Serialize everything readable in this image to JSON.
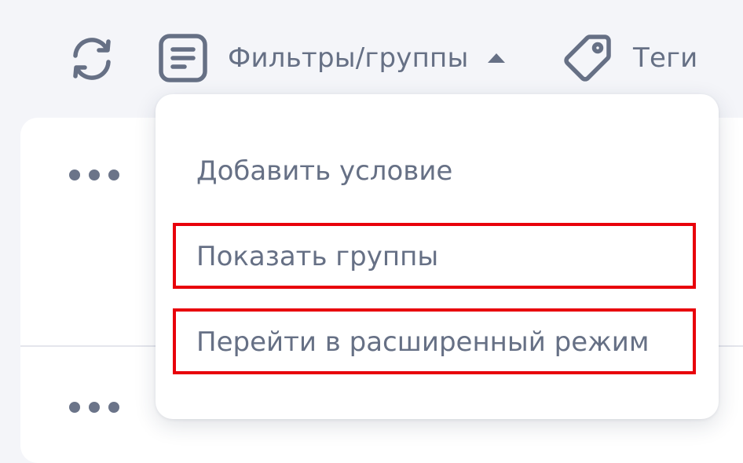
{
  "toolbar": {
    "refresh_icon": "refresh-icon",
    "filters_icon": "list-document-icon",
    "filters_label": "Фильтры/группы",
    "filters_caret_icon": "caret-up-icon",
    "tags_icon": "tag-icon",
    "tags_label": "Теги"
  },
  "dropdown": {
    "items": [
      {
        "label": "Добавить условие"
      },
      {
        "label": "Показать группы"
      },
      {
        "label": "Перейти в расширенный режим"
      }
    ]
  },
  "table": {
    "row_action_icon": "more-dots-icon"
  },
  "colors": {
    "text": "#667085",
    "highlight": "#e8000b",
    "background": "#f4f5f9",
    "surface": "#ffffff"
  }
}
